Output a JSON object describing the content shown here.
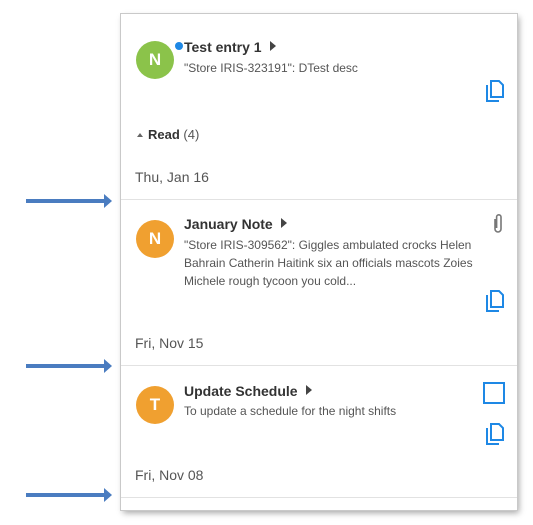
{
  "colors": {
    "accent": "#1e88e5",
    "avatar_green": "#8bc34a",
    "avatar_orange": "#f0a030",
    "arrow": "#4a7cc0"
  },
  "unread_entry": {
    "avatar": "N",
    "title": "Test entry 1",
    "desc": "\"Store IRIS-323191\": DTest desc"
  },
  "read_section": {
    "label": "Read",
    "count": "(4)"
  },
  "entries": [
    {
      "date": "Thu, Jan 16",
      "avatar": "N",
      "title": "January Note",
      "desc": "\"Store IRIS-309562\": Giggles ambulated crocks Helen Bahrain Catherin Haitink six an officials mascots Zoies Michele rough tycoon you cold..."
    },
    {
      "date": "Fri, Nov 15",
      "avatar": "T",
      "title": "Update Schedule",
      "desc": "To update a schedule for the night shifts"
    }
  ],
  "last_date": "Fri, Nov 08"
}
